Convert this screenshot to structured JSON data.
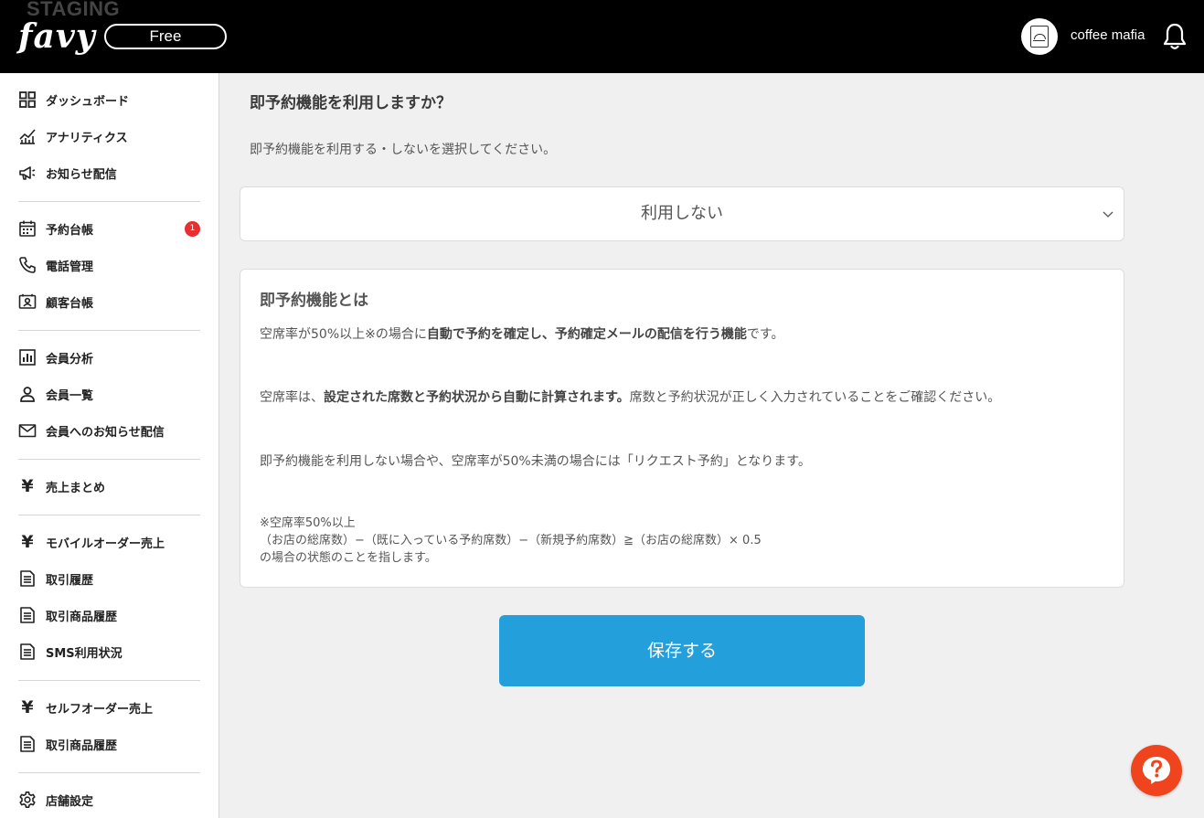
{
  "header": {
    "environment_label": "STAGING",
    "logo_text": "favy",
    "plan_label": "Free",
    "shop_name": "coffee mafia",
    "icons": [
      "shop-avatar",
      "bell-icon"
    ]
  },
  "sidebar": {
    "items": [
      {
        "label": "ダッシュボード",
        "icon": "dashboard-grid-icon"
      },
      {
        "label": "アナリティクス",
        "icon": "analytics-chart-icon"
      },
      {
        "label": "お知らせ配信",
        "icon": "megaphone-icon"
      },
      {
        "label": "予約台帳",
        "icon": "calendar-icon",
        "badge": "1"
      },
      {
        "label": "電話管理",
        "icon": "phone-icon"
      },
      {
        "label": "顧客台帳",
        "icon": "contact-card-icon"
      },
      {
        "label": "会員分析",
        "icon": "bar-chart-icon"
      },
      {
        "label": "会員一覧",
        "icon": "person-icon"
      },
      {
        "label": "会員へのお知らせ配信",
        "icon": "envelope-icon"
      },
      {
        "label": "売上まとめ",
        "icon": "yen-icon"
      },
      {
        "label": "モバイルオーダー売上",
        "icon": "yen-icon"
      },
      {
        "label": "取引履歴",
        "icon": "document-icon"
      },
      {
        "label": "取引商品履歴",
        "icon": "document-icon"
      },
      {
        "label": "SMS利用状況",
        "icon": "document-icon"
      },
      {
        "label": "セルフオーダー売上",
        "icon": "yen-icon"
      },
      {
        "label": "取引商品履歴",
        "icon": "document-icon"
      },
      {
        "label": "店舗設定",
        "icon": "gear-icon"
      }
    ],
    "yen_glyph": "¥"
  },
  "main": {
    "question": "即予約機能を利用しますか？",
    "instruction": "即予約機能を利用する・しないを選択してください。",
    "select": {
      "value": "利用しない"
    },
    "info": {
      "title": "即予約機能とは",
      "p1_a": "空席率が50%以上※の場合に",
      "p1_b": "自動で予約を確定し、予約確定メールの配信を行う機能",
      "p1_c": "です。",
      "p2_a": "空席率は、",
      "p2_b": "設定された席数と予約状況から自動に計算されます。",
      "p2_c": "席数と予約状況が正しく入力されていることをご確認ください。",
      "p3": "即予約機能を利用しない場合や、空席率が50%未満の場合には「リクエスト予約」となります。",
      "note_1": "※空席率50%以上",
      "note_2": "（お店の総席数）−（既に入っている予約席数）−（新規予約席数）≧（お店の総席数）× 0.5",
      "note_3": "の場合の状態のことを指します。"
    },
    "save_label": "保存する"
  },
  "colors": {
    "header_bg": "#000000",
    "accent": "#23a0dc",
    "badge": "#e82e2e",
    "help_button": "#f0441f"
  }
}
